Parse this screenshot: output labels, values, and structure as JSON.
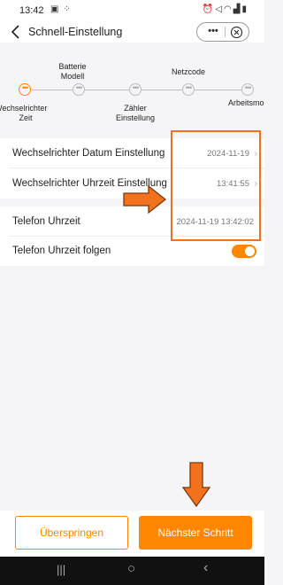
{
  "status_bar": {
    "time": "13:42",
    "left_icons": [
      "gallery-icon",
      "grid-app-icon"
    ],
    "right_icons": [
      "alarm-icon",
      "mute-icon",
      "wifi-icon",
      "signal-icon",
      "battery-icon"
    ]
  },
  "header": {
    "title": "Schnell-Einstellung",
    "back_icon": "chevron-left-icon",
    "capsule_more": "•••",
    "capsule_close_icon": "close-circle-icon"
  },
  "stepper": {
    "top_labels": {
      "battery_model": [
        "Batterie",
        "Modell"
      ],
      "grid_code": [
        "Netzcode"
      ]
    },
    "bottom_labels": {
      "inverter_time": [
        "Wechselrichter",
        "Zeit"
      ],
      "meter_settings": [
        "Zähler",
        "Einstellung"
      ],
      "working_mode": [
        "Arbeitsmo"
      ]
    },
    "dot_glyph": "•••",
    "active_index": 0,
    "step_count": 5
  },
  "settings": {
    "date_row": {
      "label": "Wechselrichter Datum Einstellung",
      "value": "2024-11-19",
      "chevron": "›"
    },
    "time_row": {
      "label": "Wechselrichter Uhrzeit Einstellung",
      "value": "13:41:55",
      "chevron": "›"
    },
    "phone_time_row": {
      "label": "Telefon Uhrzeit",
      "value": "2024-11-19 13:42:02"
    },
    "follow_phone_row": {
      "label": "Telefon Uhrzeit folgen",
      "toggle_on": true
    }
  },
  "footer": {
    "skip_label": "Überspringen",
    "next_label": "Nächster Schritt"
  },
  "nav_bar": {
    "recents": "|||",
    "home": "○",
    "back": "‹"
  },
  "colors": {
    "accent": "#ff8600",
    "annotation": "#f2711c"
  }
}
